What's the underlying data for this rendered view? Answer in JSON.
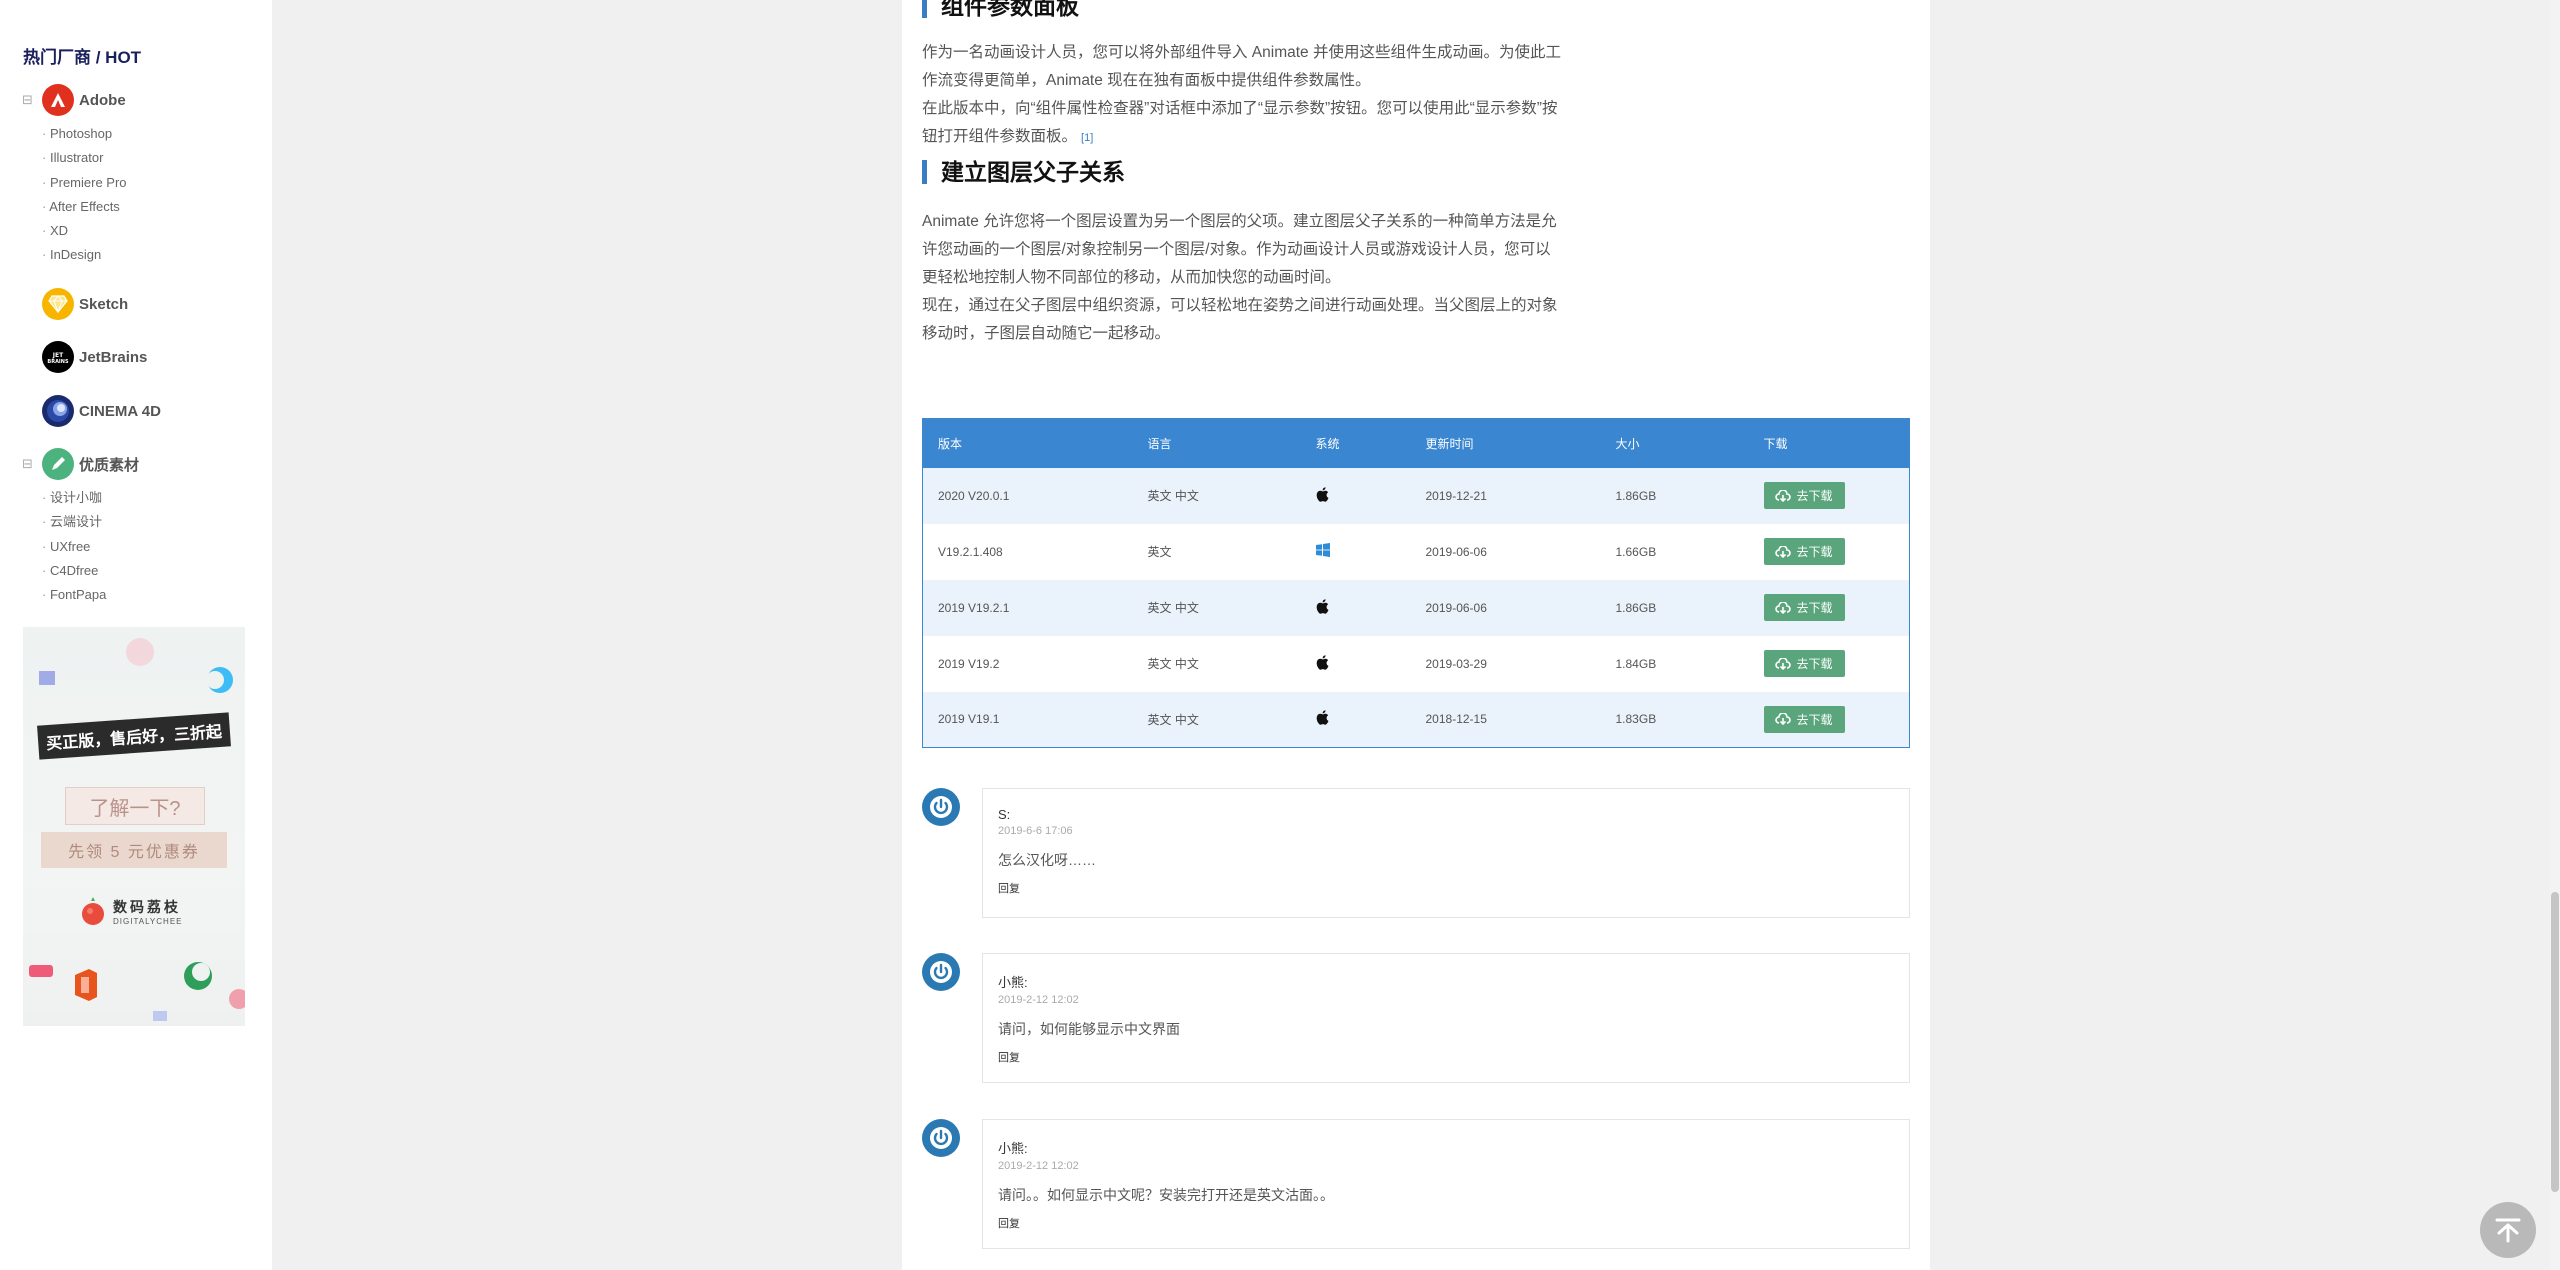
{
  "sidebar": {
    "title": "热门厂商 / HOT",
    "vendors": [
      {
        "name": "Adobe",
        "toggle": "⊟",
        "icon": "adobe-logo-icon",
        "color": "#e0301e",
        "items": [
          "Photoshop",
          "Illustrator",
          "Premiere Pro",
          "After Effects",
          "XD",
          "InDesign"
        ]
      },
      {
        "name": "Sketch",
        "icon": "sketch-logo-icon",
        "color": "#f7b500"
      },
      {
        "name": "JetBrains",
        "icon": "jetbrains-logo-icon",
        "color": "#000000",
        "logo_text": "JET BRAINS"
      },
      {
        "name": "CINEMA 4D",
        "icon": "cinema4d-logo-icon",
        "color": "#1a2b6d"
      },
      {
        "name": "优质素材",
        "toggle": "⊟",
        "icon": "pencil-logo-icon",
        "color": "#4db37e",
        "items": [
          "设计小咖",
          "云端设计",
          "UXfree",
          "C4Dfree",
          "FontPapa"
        ]
      }
    ]
  },
  "ad": {
    "ribbon": "买正版，售后好，三折起",
    "learn": "了解一下?",
    "coupon": "先领 5 元优惠券",
    "brand_cn": "数码荔枝",
    "brand_en": "DIGITALYCHEE"
  },
  "article": {
    "section1": {
      "title": "组件参数面板",
      "lines": [
        "作为一名动画设计人员，您可以将外部组件导入 Animate 并使用这些组件生成动画。为使此工",
        "作流变得更简单，Animate 现在在独有面板中提供组件参数属性。",
        "在此版本中，向“组件属性检查器”对话框中添加了“显示参数”按钮。您可以使用此“显示参数”按",
        "钮打开组件参数面板。"
      ],
      "cite": "[1]"
    },
    "section2": {
      "title": "建立图层父子关系",
      "lines": [
        "Animate 允许您将一个图层设置为另一个图层的父项。建立图层父子关系的一种简单方法是允",
        "许您动画的一个图层/对象控制另一个图层/对象。作为动画设计人员或游戏设计人员，您可以",
        "更轻松地控制人物不同部位的移动，从而加快您的动画时间。",
        "现在，通过在父子图层中组织资源，可以轻松地在姿势之间进行动画处理。当父图层上的对象",
        "移动时，子图层自动随它一起移动。"
      ]
    }
  },
  "table": {
    "headers": [
      "版本",
      "语言",
      "系统",
      "更新时间",
      "大小",
      "下载"
    ],
    "rows": [
      {
        "version": "2020 V20.0.1",
        "lang": "英文 中文",
        "os": "apple-icon",
        "date": "2019-12-21",
        "size": "1.86GB",
        "download": "去下载"
      },
      {
        "version": "V19.2.1.408",
        "lang": "英文",
        "os": "windows-icon",
        "date": "2019-06-06",
        "size": "1.66GB",
        "download": "去下载"
      },
      {
        "version": "2019 V19.2.1",
        "lang": "英文 中文",
        "os": "apple-icon",
        "date": "2019-06-06",
        "size": "1.86GB",
        "download": "去下载"
      },
      {
        "version": "2019 V19.2",
        "lang": "英文 中文",
        "os": "apple-icon",
        "date": "2019-03-29",
        "size": "1.84GB",
        "download": "去下载"
      },
      {
        "version": "2019 V19.1",
        "lang": "英文 中文",
        "os": "apple-icon",
        "date": "2018-12-15",
        "size": "1.83GB",
        "download": "去下载"
      }
    ]
  },
  "comments": [
    {
      "name": "S:",
      "time": "2019-6-6 17:06",
      "text": "怎么汉化呀……",
      "reply": "回复"
    },
    {
      "name": "小熊:",
      "time": "2019-2-12 12:02",
      "text": "请问，如何能够显示中文界面",
      "reply": "回复"
    },
    {
      "name": "小熊:",
      "time": "2019-2-12 12:02",
      "text": "请问。。如何显示中文呢？安装完打开还是英文沽面。。",
      "reply": "回复"
    }
  ],
  "colors": {
    "accent": "#3a86d1",
    "download_button": "#5aa57b",
    "heading_bar": "#3a7dc4",
    "avatar": "#2a79b3"
  }
}
